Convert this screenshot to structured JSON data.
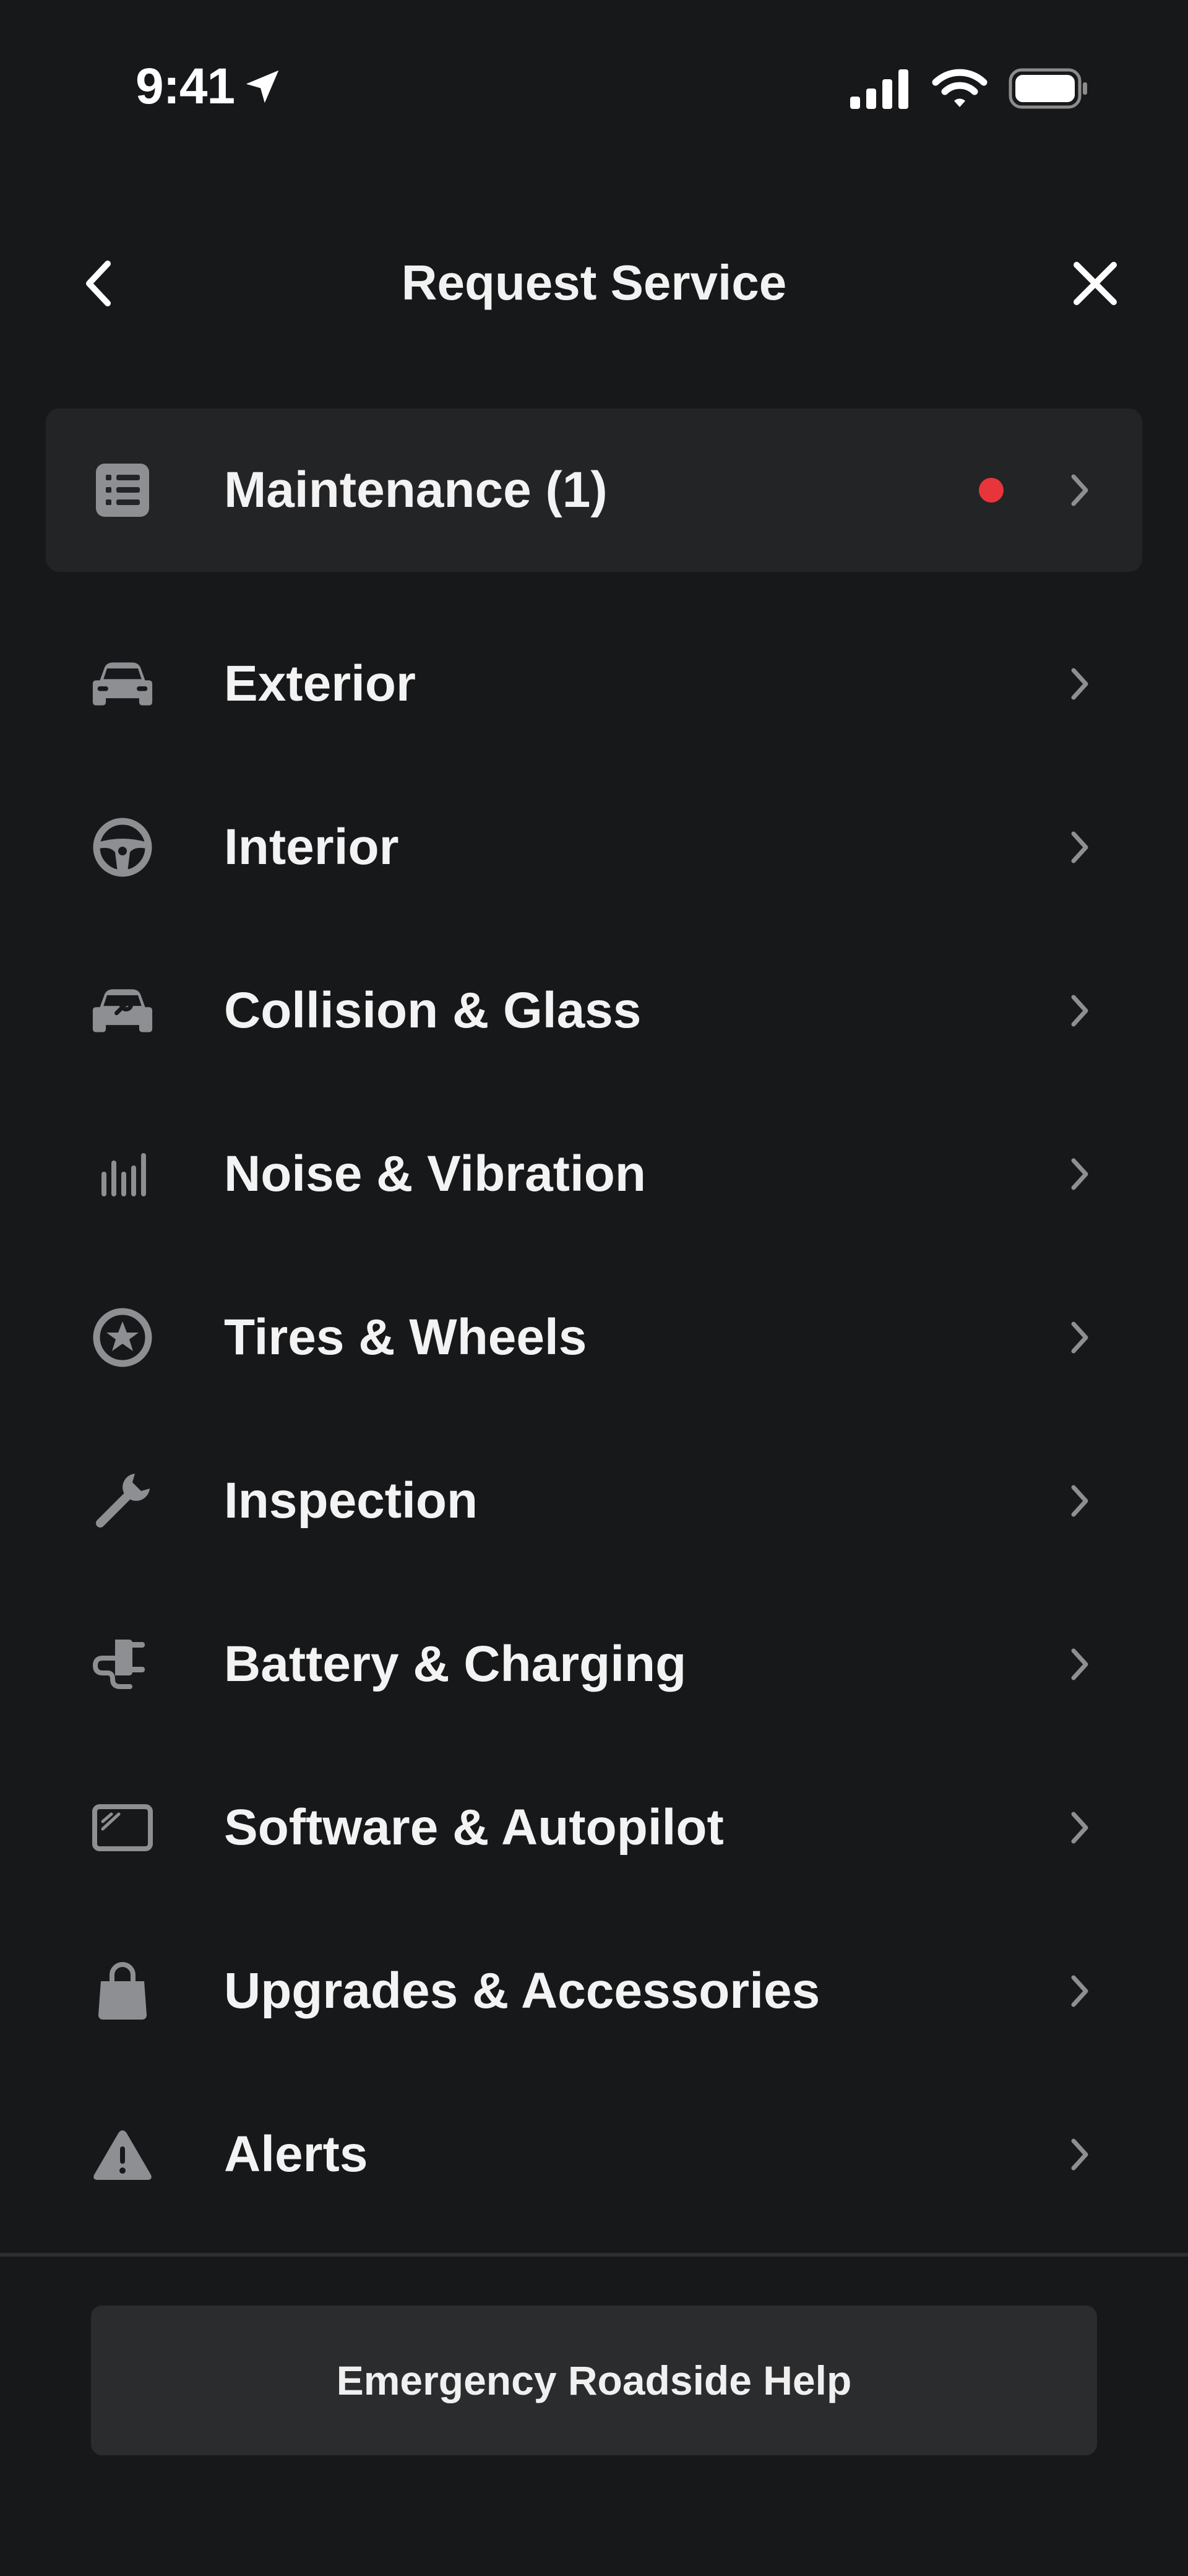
{
  "status_bar": {
    "time": "9:41",
    "icons": [
      "location-arrow-icon",
      "cellular-signal-icon",
      "wifi-icon",
      "battery-icon"
    ]
  },
  "header": {
    "title": "Request Service",
    "back_icon": "chevron-left-icon",
    "close_icon": "close-icon"
  },
  "colors": {
    "background": "#17181a",
    "highlight_row": "#232426",
    "icon_gray": "#8e8f93",
    "notification_dot": "#e8353b",
    "button_background": "#2b2c2e"
  },
  "service_items": [
    {
      "label": "Maintenance (1)",
      "icon": "checklist-icon",
      "has_notification": true
    },
    {
      "label": "Exterior",
      "icon": "car-front-icon"
    },
    {
      "label": "Interior",
      "icon": "steering-wheel-icon"
    },
    {
      "label": "Collision & Glass",
      "icon": "car-wrench-icon"
    },
    {
      "label": "Noise & Vibration",
      "icon": "audio-bars-icon"
    },
    {
      "label": "Tires & Wheels",
      "icon": "wheel-icon"
    },
    {
      "label": "Inspection",
      "icon": "wrench-icon"
    },
    {
      "label": "Battery & Charging",
      "icon": "plug-icon"
    },
    {
      "label": "Software & Autopilot",
      "icon": "display-icon"
    },
    {
      "label": "Upgrades & Accessories",
      "icon": "shopping-bag-icon"
    },
    {
      "label": "Alerts",
      "icon": "warning-icon"
    }
  ],
  "footer": {
    "button_label": "Emergency Roadside Help"
  }
}
